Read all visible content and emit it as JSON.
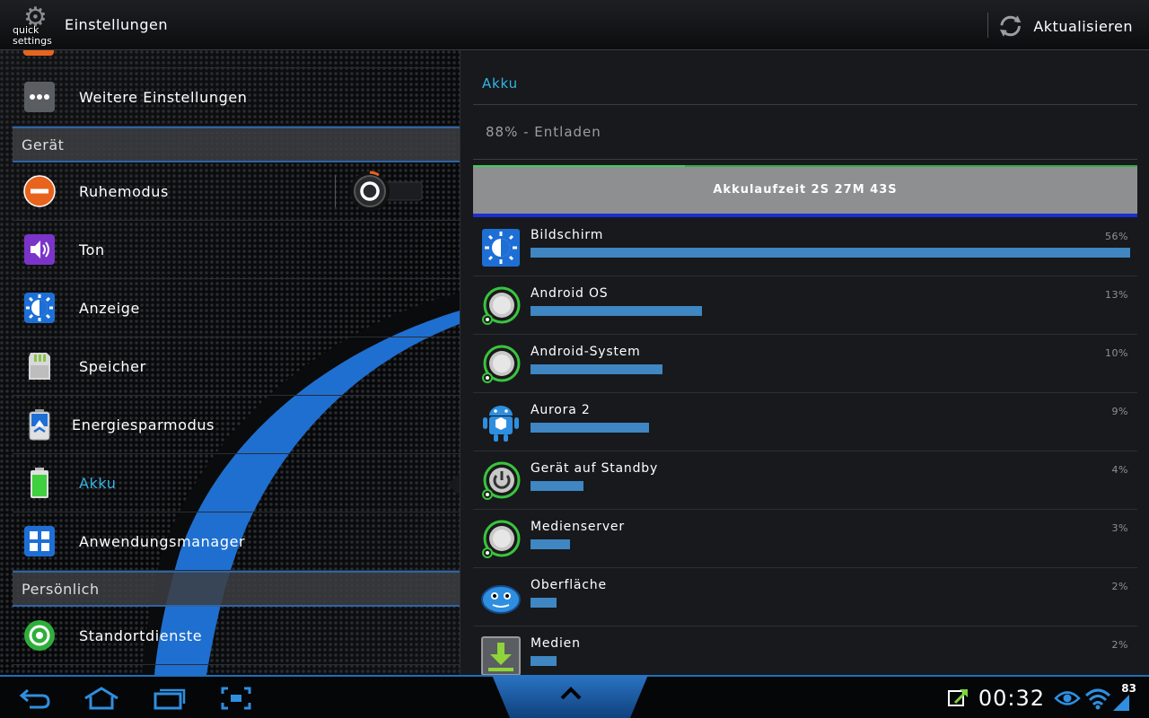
{
  "action_bar": {
    "logo_text": "quick settings",
    "title": "Einstellungen",
    "refresh_label": "Aktualisieren"
  },
  "left_pane": {
    "more_settings": "Weitere Einstellungen",
    "section_device": "Gerät",
    "items_device": [
      {
        "label": "Ruhemodus",
        "icon": "minus-circle-icon"
      },
      {
        "label": "Ton",
        "icon": "speaker-icon"
      },
      {
        "label": "Anzeige",
        "icon": "brightness-gear-icon"
      },
      {
        "label": "Speicher",
        "icon": "sd-card-icon"
      },
      {
        "label": "Energiesparmodus",
        "icon": "recycle-battery-icon"
      },
      {
        "label": "Akku",
        "icon": "battery-icon",
        "selected": true
      },
      {
        "label": "Anwendungsmanager",
        "icon": "grid-apps-icon"
      }
    ],
    "section_personal": "Persönlich",
    "items_personal": [
      {
        "label": "Standortdienste",
        "icon": "location-target-icon"
      }
    ]
  },
  "right_pane": {
    "title": "Akku",
    "status": "88% - Entladen",
    "graph_label": "Akkulaufzeit 2S 27M 43S",
    "usage": [
      {
        "name": "Bildschirm",
        "percent": "56%",
        "value": 56,
        "icon": "brightness-icon"
      },
      {
        "name": "Android OS",
        "percent": "13%",
        "value": 13,
        "icon": "android-os-icon"
      },
      {
        "name": "Android-System",
        "percent": "10%",
        "value": 10,
        "icon": "android-system-icon"
      },
      {
        "name": "Aurora 2",
        "percent": "9%",
        "value": 9,
        "icon": "android-robot-icon"
      },
      {
        "name": "Gerät auf Standby",
        "percent": "4%",
        "value": 4,
        "icon": "standby-power-icon"
      },
      {
        "name": "Medienserver",
        "percent": "3%",
        "value": 3,
        "icon": "media-server-icon"
      },
      {
        "name": "Oberfläche",
        "percent": "2%",
        "value": 2,
        "icon": "ui-blob-icon"
      },
      {
        "name": "Medien",
        "percent": "2%",
        "value": 2,
        "icon": "download-icon"
      }
    ]
  },
  "system_bar": {
    "clock": "00:32",
    "battery_level": "83"
  },
  "colors": {
    "accent": "#33b5e5",
    "usage_bar": "#3f86c2",
    "section_border": "#2e64a8",
    "graph_bg": "#8e8f91"
  }
}
